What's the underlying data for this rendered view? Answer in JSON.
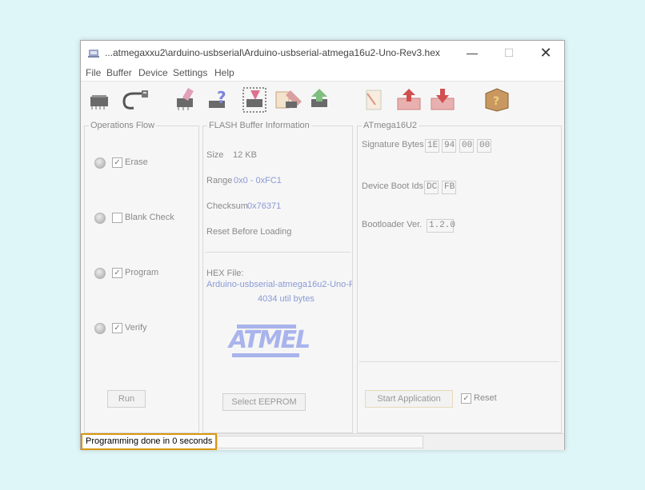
{
  "window": {
    "title": "...atmegaxxu2\\arduino-usbserial\\Arduino-usbserial-atmega16u2-Uno-Rev3.hex",
    "minimize": "—",
    "maximize": "☐",
    "close": "✕"
  },
  "menu": [
    "File",
    "Buffer",
    "Device",
    "Settings",
    "Help"
  ],
  "toolbar": {
    "icons": [
      "chip-select-icon",
      "usb-connect-icon",
      "erase-chip-icon",
      "blank-check-icon",
      "program-chip-icon",
      "verify-chip-icon",
      "read-chip-icon",
      "load-hex-icon",
      "load-buffer-icon",
      "save-buffer-icon",
      "help-book-icon"
    ]
  },
  "operations": {
    "title": "Operations Flow",
    "items": [
      {
        "label": "Erase",
        "checked": true
      },
      {
        "label": "Blank Check",
        "checked": false
      },
      {
        "label": "Program",
        "checked": true
      },
      {
        "label": "Verify",
        "checked": true
      }
    ],
    "run_label": "Run"
  },
  "flash": {
    "title": "FLASH Buffer Information",
    "size_label": "Size",
    "size_value": "12 KB",
    "range_label": "Range",
    "range_value": "0x0 - 0xFC1",
    "checksum_label": "Checksum",
    "checksum_value": "0x76371",
    "reset_label": "Reset Before Loading",
    "hex_label": "HEX File:",
    "hex_file": "Arduino-usbserial-atmega16u2-Uno-R",
    "util_bytes": "4034 util bytes",
    "logo_text": "ATMEL",
    "eeprom_label": "Select EEPROM"
  },
  "device": {
    "title": "ATmega16U2",
    "signature_label": "Signature Bytes",
    "signature": [
      "1E",
      "94",
      "00",
      "00"
    ],
    "boot_ids_label": "Device Boot Ids",
    "boot_ids": [
      "DC",
      "FB"
    ],
    "bootloader_label": "Bootloader Ver.",
    "bootloader_value": "1.2.0",
    "start_app_label": "Start Application",
    "reset_label": "Reset",
    "reset_checked": true
  },
  "status": {
    "text": "Programming done in 0 seconds"
  }
}
